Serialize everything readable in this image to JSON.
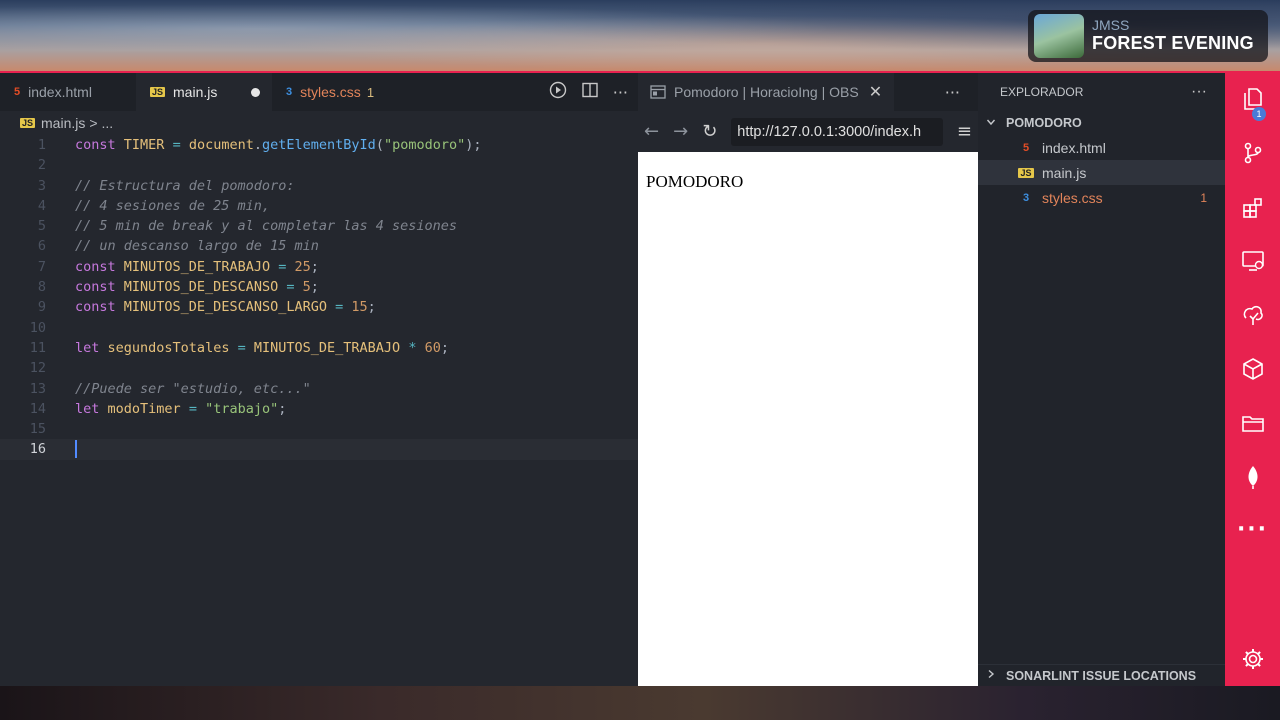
{
  "music": {
    "artist": "JMSS",
    "song": "FOREST EVENING"
  },
  "editor": {
    "tabs": [
      {
        "label": "index.html",
        "icon": "html5-icon"
      },
      {
        "label": "main.js",
        "icon": "js-icon"
      },
      {
        "label": "styles.css",
        "icon": "css3-icon",
        "problems": "1"
      }
    ],
    "breadcrumb": {
      "file": "main.js",
      "rest": "> ..."
    },
    "code_lines": [
      {
        "n": "1",
        "tokens": [
          [
            "k",
            "const"
          ],
          [
            "p",
            " "
          ],
          [
            "v",
            "TIMER"
          ],
          [
            "p",
            " "
          ],
          [
            "o",
            "="
          ],
          [
            "p",
            " "
          ],
          [
            "v",
            "document"
          ],
          [
            "p",
            "."
          ],
          [
            "f",
            "getElementById"
          ],
          [
            "p",
            "("
          ],
          [
            "s",
            "\"pomodoro\""
          ],
          [
            "p",
            ");"
          ]
        ]
      },
      {
        "n": "2",
        "tokens": []
      },
      {
        "n": "3",
        "tokens": [
          [
            "c",
            "// Estructura del pomodoro:"
          ]
        ]
      },
      {
        "n": "4",
        "tokens": [
          [
            "c",
            "// 4 sesiones de 25 min,"
          ]
        ]
      },
      {
        "n": "5",
        "tokens": [
          [
            "c",
            "// 5 min de break y al completar las 4 sesiones"
          ]
        ]
      },
      {
        "n": "6",
        "tokens": [
          [
            "c",
            "// un descanso largo de 15 min"
          ]
        ]
      },
      {
        "n": "7",
        "tokens": [
          [
            "k",
            "const"
          ],
          [
            "p",
            " "
          ],
          [
            "v",
            "MINUTOS_DE_TRABAJO"
          ],
          [
            "p",
            " "
          ],
          [
            "o",
            "="
          ],
          [
            "p",
            " "
          ],
          [
            "n",
            "25"
          ],
          [
            "p",
            ";"
          ]
        ]
      },
      {
        "n": "8",
        "tokens": [
          [
            "k",
            "const"
          ],
          [
            "p",
            " "
          ],
          [
            "v",
            "MINUTOS_DE_DESCANSO"
          ],
          [
            "p",
            " "
          ],
          [
            "o",
            "="
          ],
          [
            "p",
            " "
          ],
          [
            "n",
            "5"
          ],
          [
            "p",
            ";"
          ]
        ]
      },
      {
        "n": "9",
        "tokens": [
          [
            "k",
            "const"
          ],
          [
            "p",
            " "
          ],
          [
            "v",
            "MINUTOS_DE_DESCANSO_LARGO"
          ],
          [
            "p",
            " "
          ],
          [
            "o",
            "="
          ],
          [
            "p",
            " "
          ],
          [
            "n",
            "15"
          ],
          [
            "p",
            ";"
          ]
        ]
      },
      {
        "n": "10",
        "tokens": []
      },
      {
        "n": "11",
        "tokens": [
          [
            "k",
            "let"
          ],
          [
            "p",
            " "
          ],
          [
            "v",
            "segundosTotales"
          ],
          [
            "p",
            " "
          ],
          [
            "o",
            "="
          ],
          [
            "p",
            " "
          ],
          [
            "v",
            "MINUTOS_DE_TRABAJO"
          ],
          [
            "p",
            " "
          ],
          [
            "o",
            "*"
          ],
          [
            "p",
            " "
          ],
          [
            "n",
            "60"
          ],
          [
            "p",
            ";"
          ]
        ]
      },
      {
        "n": "12",
        "tokens": []
      },
      {
        "n": "13",
        "tokens": [
          [
            "c",
            "//Puede ser \"estudio, etc...\""
          ]
        ]
      },
      {
        "n": "14",
        "tokens": [
          [
            "k",
            "let"
          ],
          [
            "p",
            " "
          ],
          [
            "v",
            "modoTimer"
          ],
          [
            "p",
            " "
          ],
          [
            "o",
            "="
          ],
          [
            "p",
            " "
          ],
          [
            "s",
            "\"trabajo\""
          ],
          [
            "p",
            ";"
          ]
        ]
      },
      {
        "n": "15",
        "tokens": []
      },
      {
        "n": "16",
        "tokens": [],
        "current": true
      }
    ]
  },
  "browser": {
    "tab_title": "Pomodoro | HoracioIng | OBS",
    "url": "http://127.0.0.1:3000/index.h",
    "page_heading": "POMODORO"
  },
  "explorer": {
    "title": "EXPLORADOR",
    "folder": "POMODORO",
    "files": [
      {
        "name": "index.html",
        "icon": "html5-icon"
      },
      {
        "name": "main.js",
        "icon": "js-icon",
        "selected": true
      },
      {
        "name": "styles.css",
        "icon": "css3-icon",
        "problems": "1"
      }
    ],
    "bottom_section": "SONARLINT ISSUE LOCATIONS"
  },
  "activity_bar": {
    "explorer_badge": "1",
    "icons": [
      "files-icon",
      "source-control-icon",
      "extensions-icon",
      "remote-explorer-icon",
      "sonarlint-icon",
      "package-icon",
      "folder-icon",
      "mongodb-leaf-icon",
      "more-icon",
      "settings-gear-icon"
    ]
  },
  "colors": {
    "accent": "#e8224f",
    "editor_bg": "#24272e",
    "keyword": "#c678dd",
    "string": "#98c379",
    "number": "#d19a66"
  }
}
